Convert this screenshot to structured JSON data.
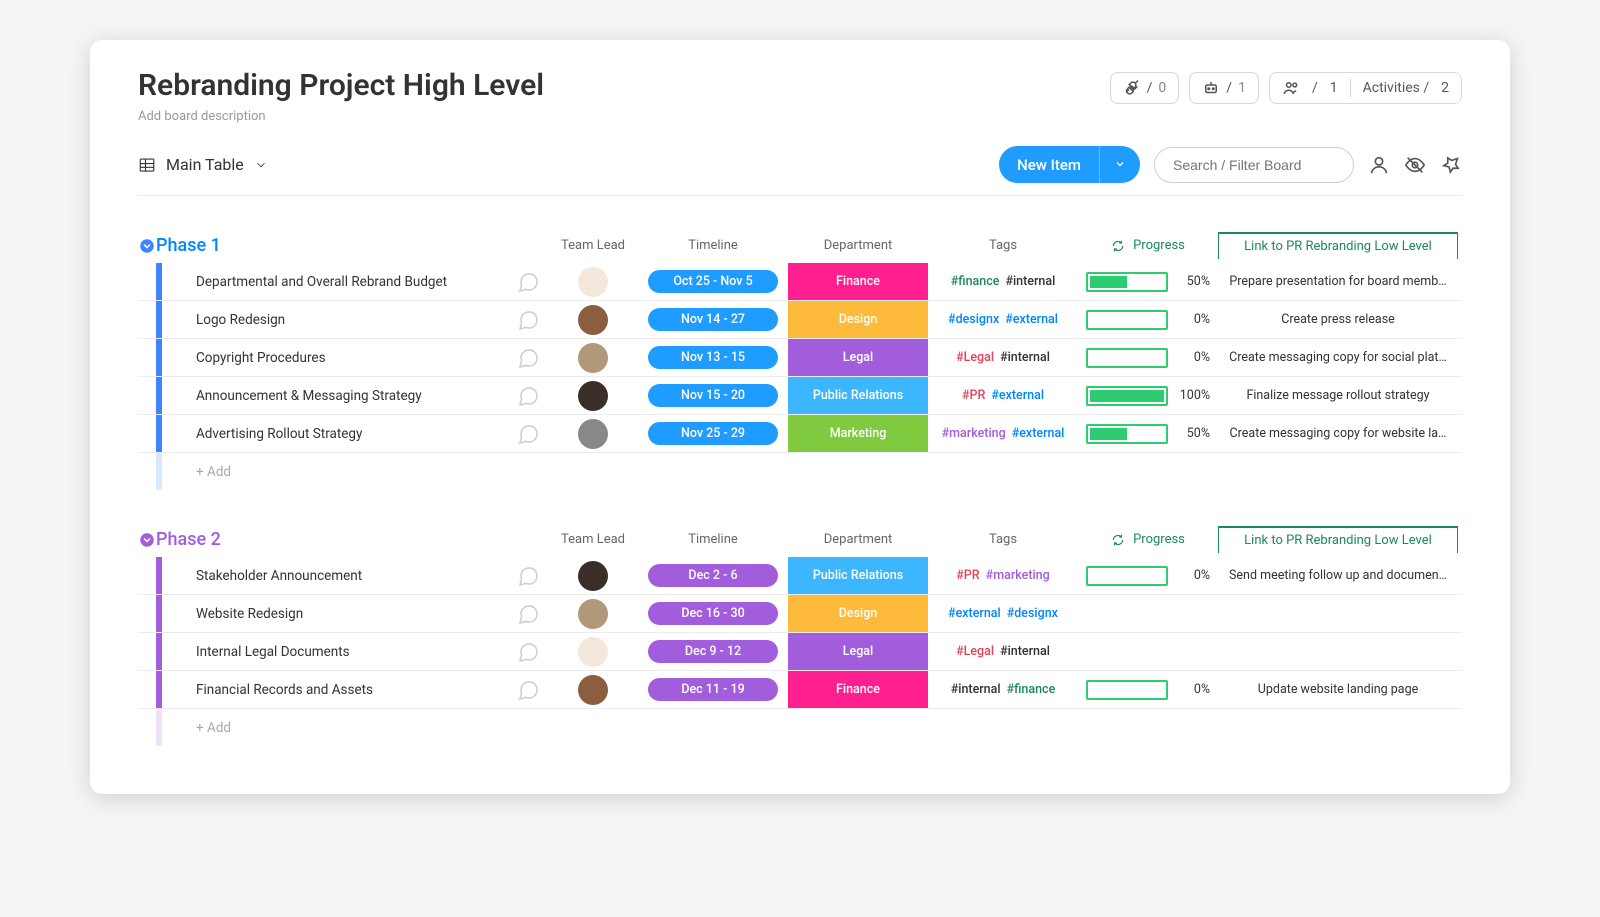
{
  "board": {
    "title": "Rebranding Project High Level",
    "desc_placeholder": "Add board description"
  },
  "stats": {
    "integrations": "0",
    "automations": "1",
    "members": "1",
    "activities_label": "Activities /",
    "activities_count": "2"
  },
  "toolbar": {
    "view_name": "Main Table",
    "new_item_label": "New Item",
    "search_placeholder": "Search / Filter Board"
  },
  "column_headers": {
    "team_lead": "Team Lead",
    "timeline": "Timeline",
    "department": "Department",
    "tags": "Tags",
    "progress": "Progress",
    "link": "Link to PR Rebranding Low Level"
  },
  "add_row_text": "+ Add",
  "tag_colors": {
    "#finance": "c-green",
    "#internal": "c-dark",
    "#designx": "c-blue",
    "#external": "c-blue",
    "#Legal": "c-red",
    "#PR": "c-red",
    "#marketing": "c-purple"
  },
  "dept_colors": {
    "Finance": "bg-pink",
    "Design": "bg-yellow",
    "Legal": "bg-purple",
    "Public Relations": "bg-lightblue",
    "Marketing": "bg-green"
  },
  "groups": [
    {
      "id": "phase1",
      "title": "Phase 1",
      "color": "#3d85ff",
      "title_class": "c-blue",
      "stripe": "stripe-blue",
      "stripe_light": "stripe-blue-light",
      "timeline_bg": "bg-blue",
      "items": [
        {
          "name": "Departmental and Overall Rebrand Budget",
          "avatar": "a1",
          "timeline": "Oct 25 - Nov 5",
          "dept": "Finance",
          "tags": [
            "#finance",
            "#internal"
          ],
          "progress": 50,
          "link": "Prepare presentation for board memb…"
        },
        {
          "name": "Logo Redesign",
          "avatar": "a2",
          "timeline": "Nov 14 - 27",
          "dept": "Design",
          "tags": [
            "#designx",
            "#external"
          ],
          "progress": 0,
          "link": "Create press release"
        },
        {
          "name": "Copyright Procedures",
          "avatar": "a3",
          "timeline": "Nov 13 - 15",
          "dept": "Legal",
          "tags": [
            "#Legal",
            "#internal"
          ],
          "progress": 0,
          "link": "Create messaging copy for social plat…"
        },
        {
          "name": "Announcement & Messaging Strategy",
          "avatar": "a4",
          "timeline": "Nov 15 - 20",
          "dept": "Public Relations",
          "tags": [
            "#PR",
            "#external"
          ],
          "progress": 100,
          "link": "Finalize message rollout strategy"
        },
        {
          "name": "Advertising Rollout Strategy",
          "avatar": "a5",
          "timeline": "Nov 25 - 29",
          "dept": "Marketing",
          "tags": [
            "#marketing",
            "#external"
          ],
          "progress": 50,
          "link": "Create messaging copy for website la…"
        }
      ]
    },
    {
      "id": "phase2",
      "title": "Phase 2",
      "color": "#a25ddc",
      "title_class": "c-purple",
      "stripe": "stripe-purple",
      "stripe_light": "stripe-purple-light",
      "timeline_bg": "bg-purple",
      "items": [
        {
          "name": "Stakeholder Announcement",
          "avatar": "a4",
          "timeline": "Dec 2 - 6",
          "dept": "Public Relations",
          "tags": [
            "#PR",
            "#marketing"
          ],
          "progress": 0,
          "link": "Send meeting follow up and documen…"
        },
        {
          "name": "Website Redesign",
          "avatar": "a3",
          "timeline": "Dec 16 - 30",
          "dept": "Design",
          "tags": [
            "#external",
            "#designx"
          ],
          "progress": null,
          "link": ""
        },
        {
          "name": "Internal Legal Documents",
          "avatar": "a1",
          "timeline": "Dec 9 - 12",
          "dept": "Legal",
          "tags": [
            "#Legal",
            "#internal"
          ],
          "progress": null,
          "link": ""
        },
        {
          "name": "Financial Records and Assets",
          "avatar": "a2",
          "timeline": "Dec 11 - 19",
          "dept": "Finance",
          "tags": [
            "#internal",
            "#finance"
          ],
          "progress": 0,
          "link": "Update website landing page"
        }
      ]
    }
  ]
}
